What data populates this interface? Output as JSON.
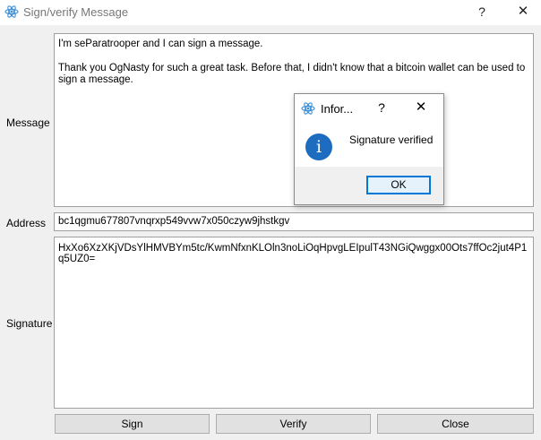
{
  "window": {
    "title": "Sign/verify Message",
    "help_glyph": "?",
    "close_glyph": "✕",
    "icon": "electrum-logo-icon"
  },
  "form": {
    "message_label": "Message",
    "message_paragraphs": [
      "I'm seParatrooper and I can sign a message.",
      "Thank you OgNasty for such a great task. Before that, I didn't know that a bitcoin wallet can be used to sign a message."
    ],
    "address_label": "Address",
    "address_value": "bc1qgmu677807vnqrxp549vvw7x050czyw9jhstkgv",
    "signature_label": "Signature",
    "signature_value": "HxXo6XzXKjVDsYlHMVBYm5tc/KwmNfxnKLOln3noLiOqHpvgLEIpulT43NGiQwggx00Ots7ffOc2jut4P1q5UZ0="
  },
  "buttons": {
    "sign": "Sign",
    "verify": "Verify",
    "close": "Close"
  },
  "dialog": {
    "title": "Infor...",
    "help_glyph": "?",
    "close_glyph": "✕",
    "message": "Signature verified",
    "ok_label": "OK",
    "info_glyph": "i",
    "icon": "information-icon"
  },
  "colors": {
    "accent": "#0078d7",
    "info_icon": "#1e6cc0",
    "window_bg": "#f0f0f0"
  }
}
